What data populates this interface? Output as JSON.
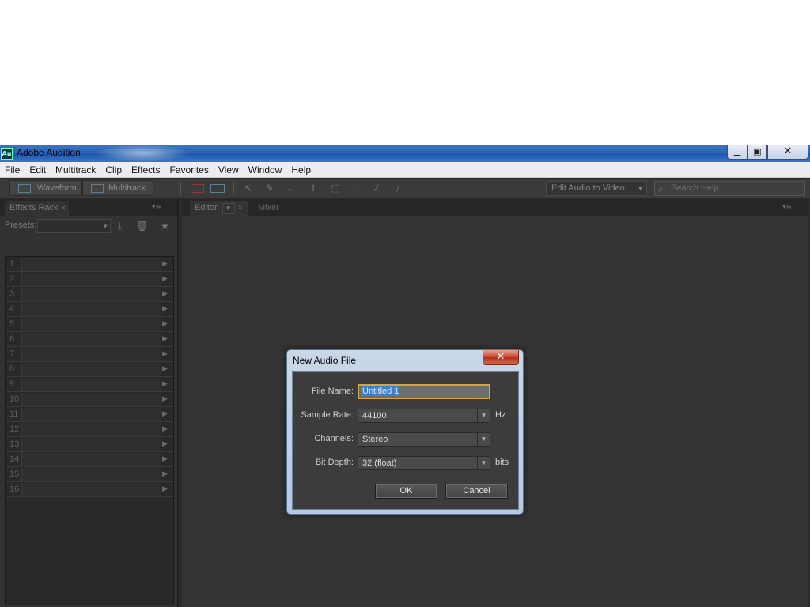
{
  "window": {
    "title": "Adobe Audition",
    "icon_text": "Au",
    "controls": {
      "minimize": "▁",
      "maximize": "▣",
      "close": "✕"
    }
  },
  "menu": [
    "File",
    "Edit",
    "Multitrack",
    "Clip",
    "Effects",
    "Favorites",
    "View",
    "Window",
    "Help"
  ],
  "toolbar": {
    "waveform_label": "Waveform",
    "multitrack_label": "Multitrack",
    "workspace_label": "Edit Audio to Video",
    "search_placeholder": "Search Help"
  },
  "left_panel": {
    "tab_label": "Effects Rack",
    "presets_label": "Presets:",
    "rack_slots": [
      "1",
      "2",
      "3",
      "4",
      "5",
      "6",
      "7",
      "8",
      "9",
      "10",
      "11",
      "12",
      "13",
      "14",
      "15",
      "16"
    ]
  },
  "right_panel": {
    "tabs": [
      {
        "label": "Editor"
      },
      {
        "label": "Mixer"
      }
    ]
  },
  "dialog": {
    "title": "New Audio File",
    "close_glyph": "✕",
    "file_name_label": "File Name:",
    "file_name_value": "Untitled 1",
    "sample_rate_label": "Sample Rate:",
    "sample_rate_value": "44100",
    "sample_rate_unit": "Hz",
    "channels_label": "Channels:",
    "channels_value": "Stereo",
    "bit_depth_label": "Bit Depth:",
    "bit_depth_value": "32 (float)",
    "bit_depth_unit": "bits",
    "ok_label": "OK",
    "cancel_label": "Cancel"
  },
  "colors": {
    "titlebar": "#2a63b5",
    "app_background": "#2b2b2b",
    "focus_border": "#d9a43a",
    "selection": "#3c7fcf",
    "dialog_close": "#c9442f"
  }
}
